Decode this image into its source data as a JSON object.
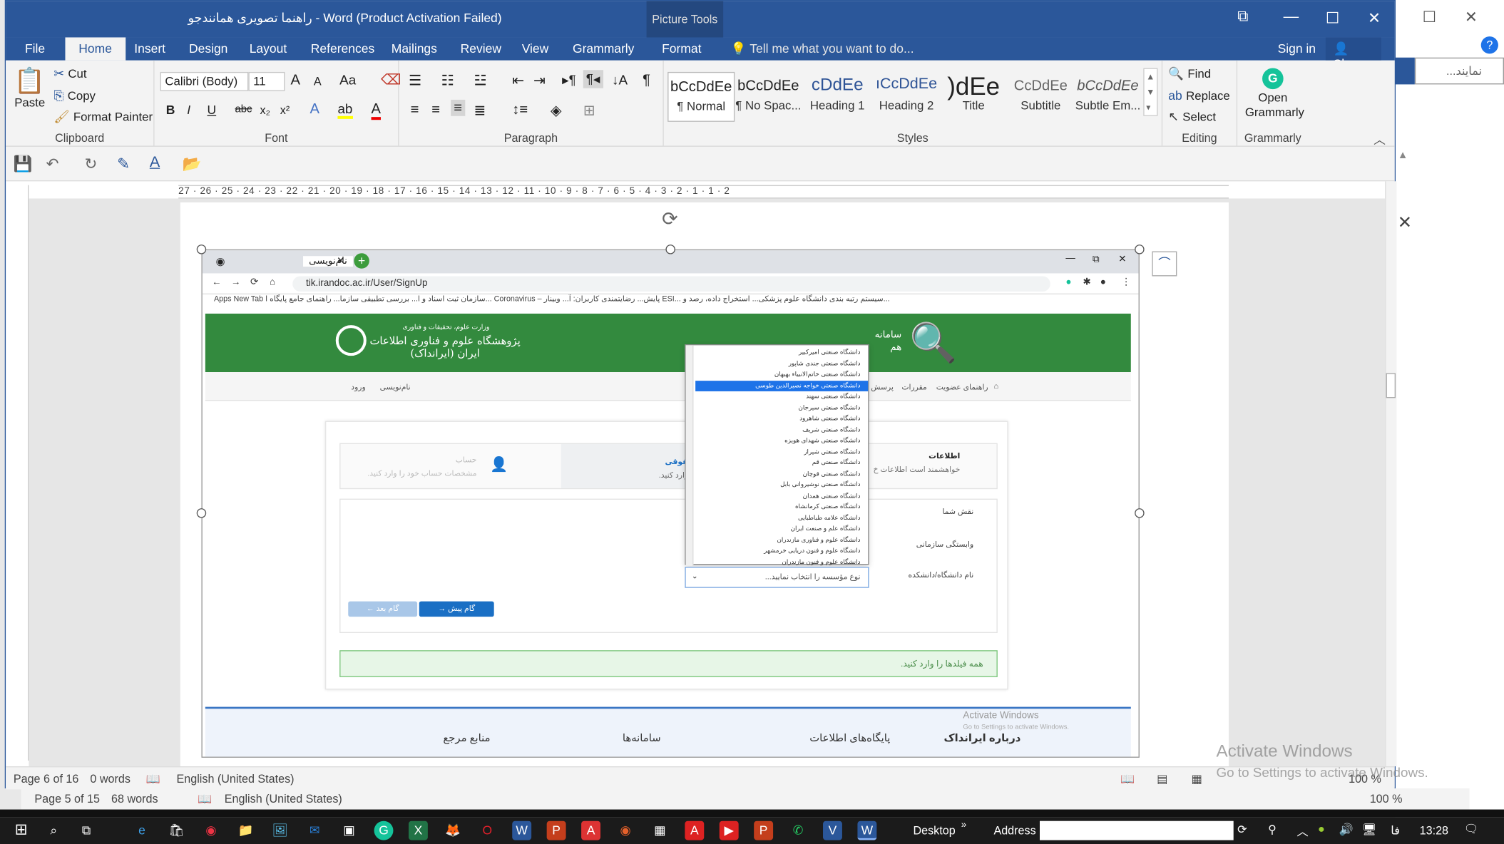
{
  "word": {
    "title": "راهنما تصویری همانندجو - Word (Product Activation Failed)",
    "picture_tools": "Picture Tools",
    "tabs": [
      "File",
      "Home",
      "Insert",
      "Design",
      "Layout",
      "References",
      "Mailings",
      "Review",
      "View",
      "Grammarly",
      "Format"
    ],
    "tell_me": "Tell me what you want to do...",
    "sign_in": "Sign in",
    "share": "Share",
    "clipboard": {
      "paste": "Paste",
      "cut": "Cut",
      "copy": "Copy",
      "format_painter": "Format Painter",
      "label": "Clipboard"
    },
    "font": {
      "name": "Calibri (Body)",
      "size": "11",
      "label": "Font",
      "grow": "A",
      "shrink": "A",
      "case": "Aa"
    },
    "paragraph": {
      "label": "Paragraph"
    },
    "styles": {
      "label": "Styles",
      "items": [
        {
          "preview": "bCcDdEe",
          "name": "¶ Normal"
        },
        {
          "preview": "bCcDdEe",
          "name": "¶ No Spac..."
        },
        {
          "preview": "cDdEe",
          "name": "Heading 1"
        },
        {
          "preview": "ıCcDdEe",
          "name": "Heading 2"
        },
        {
          "preview": ")dEe",
          "name": "Title"
        },
        {
          "preview": "CcDdEe",
          "name": "Subtitle"
        },
        {
          "preview": "bCcDdEe",
          "name": "Subtle Em..."
        }
      ]
    },
    "editing": {
      "find": "Find",
      "replace": "Replace",
      "select": "Select",
      "label": "Editing"
    },
    "grammarly": {
      "open": "Open Grammarly",
      "label": "Grammarly"
    },
    "ruler_text": "27 · 26 · 25 · 24 · 23 · 22 · 21 · 20 · 19 · 18 · 17 · 16 · 15 · 14 · 13 · 12 · 11 · 10 · 9 · 8 · 7 · 6 · 5 · 4 · 3 · 2 · 1 · 1 · 2",
    "status": {
      "page": "Page 6 of 16",
      "words": "0 words",
      "language": "English (United States)",
      "zoom": "100 %"
    },
    "status_back": {
      "page": "Page 5 of 15",
      "words": "68 words",
      "language": "English (United States)",
      "zoom": "100 %"
    }
  },
  "embedded": {
    "tab_title": "نام‌نویسی",
    "url": "tik.irandoc.ac.ir/User/SignUp",
    "bookmarks": "Apps   New Tab   سازمان ثبت اسناد و ا...   بررسی تطبیقی سازما...   راهنمای جامع پایگاه ا...   Coronavirus – پایش...   رضایتمندی کاربران: آ...   وبینار   ESI... سیستم رتبه بندی   دانشگاه علوم پزشکی...   استخراج داده، رصد و...",
    "site_title": "پژوهشگاه علوم و فناوری اطلاعات ایران (ایرانداک)",
    "site_subtitle": "وزارت علوم، تحقیقات و فناوری",
    "system_name": "سامانه هم",
    "nav": {
      "register": "نام‌نویسی",
      "login": "ورود",
      "guide": "راهنمای عضویت",
      "rules": "مقررات",
      "questions": "پرسش"
    },
    "steps": {
      "info": "اطلاعات",
      "info_desc": "خواهشمند است اطلاعات خ",
      "legal": "اطلاعات شخص حقوقی",
      "legal_desc": "اطلاعات مؤسسه را وارد کنید.",
      "account": "حساب",
      "account_desc": "مشخصات حساب خود را وارد کنید."
    },
    "form": {
      "role": "نقش شما",
      "affiliation": "وابستگی سازمانی",
      "university": "نام دانشگاه/دانشکده",
      "select_placeholder": "نوع مؤسسه را انتخاب نمایید..."
    },
    "buttons": {
      "next": "گام پیش",
      "prev": "گام بعد"
    },
    "alert": "همه فیلدها را وارد کنید.",
    "dropdown_options": [
      "دانشگاه صنعتی امیرکبیر",
      "دانشگاه صنعتی جندی شاپور",
      "دانشگاه صنعتی خاتم‌الانبیاء بهبهان",
      "دانشگاه صنعتی خواجه نصیرالدین طوسی",
      "دانشگاه صنعتی سهند",
      "دانشگاه صنعتی سیرجان",
      "دانشگاه صنعتی شاهرود",
      "دانشگاه صنعتی شریف",
      "دانشگاه صنعتی شهدای هویزه",
      "دانشگاه صنعتی شیراز",
      "دانشگاه صنعتی قم",
      "دانشگاه صنعتی قوچان",
      "دانشگاه صنعتی نوشیروانی بابل",
      "دانشگاه صنعتی همدان",
      "دانشگاه صنعتی کرمانشاه",
      "دانشگاه علامه طباطبایی",
      "دانشگاه علم و صنعت ایران",
      "دانشگاه علوم و فناوری مازندران",
      "دانشگاه علوم و فنون دریایی خرمشهر",
      "دانشگاه علوم و فنون مازندران"
    ],
    "highlighted_index": 3,
    "footer": {
      "about": "درباره ایرانداک",
      "databases": "پایگاه‌های اطلاعات",
      "systems": "سامانه‌ها",
      "references": "منابع مرجع"
    },
    "activate_small": "Activate Windows",
    "activate_small_sub": "Go to Settings to activate Windows."
  },
  "watermark": {
    "line1": "Activate Windows",
    "line2": "Go to Settings to activate Windows."
  },
  "taskbar": {
    "desktop": "Desktop",
    "address": "Address",
    "lang": "فا",
    "time": "13:28"
  },
  "background_window": {
    "search_placeholder": "نمایند..."
  },
  "colors": {
    "word_blue": "#2b579a",
    "site_green": "#338a3e",
    "highlight": "#1e73e8",
    "step_blue": "#1a6fc4",
    "alert_bg": "#e7f6e7"
  }
}
